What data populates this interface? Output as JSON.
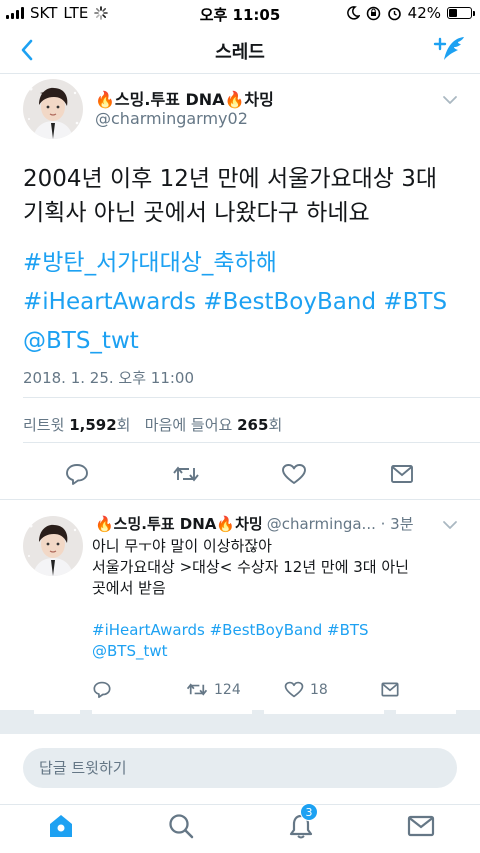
{
  "status_bar": {
    "carrier": "SKT",
    "network": "LTE",
    "time": "오후 11:05",
    "battery_percent_label": "42%",
    "battery_level": 0.42
  },
  "nav": {
    "title": "스레드"
  },
  "main_tweet": {
    "display_name": "🔥스밍.투표 DNA🔥차밍",
    "handle": "@charmingarmy02",
    "text_lines": [
      "2004년 이후 12년 만에 서울가요대상 3대",
      "기획사 아닌 곳에서 나왔다구 하네요"
    ],
    "hashtag_lines": [
      "#방탄_서가대대상_축하해",
      "#iHeartAwards #BestBoyBand #BTS",
      "@BTS_twt"
    ],
    "timestamp": "2018. 1. 25. 오후 11:00",
    "retweets_label": "리트윗",
    "retweets_count": "1,592",
    "retweets_unit": "회",
    "likes_label": "마음에 들어요",
    "likes_count": "265",
    "likes_unit": "회"
  },
  "reply_tweet": {
    "display_name": "🔥스밍.투표 DNA🔥차밍",
    "handle_time": "@charminga... · 3분",
    "lines": [
      "아니 무ㅜ야 말이 이상하잖아",
      "서울가요대상 >대상< 수상자 12년 만에 3대 아닌",
      "곳에서 받음"
    ],
    "link_lines": [
      "#iHeartAwards #BestBoyBand #BTS",
      "@BTS_twt"
    ],
    "retweet_count": "124",
    "like_count": "18"
  },
  "reply_bar": {
    "placeholder": "답글 트윗하기"
  },
  "tab_bar": {
    "notifications_badge": "3"
  },
  "colors": {
    "accent": "#1da1f2",
    "secondary_text": "#657786",
    "divider": "#e1e8ed",
    "band": "#e6ecf0"
  }
}
